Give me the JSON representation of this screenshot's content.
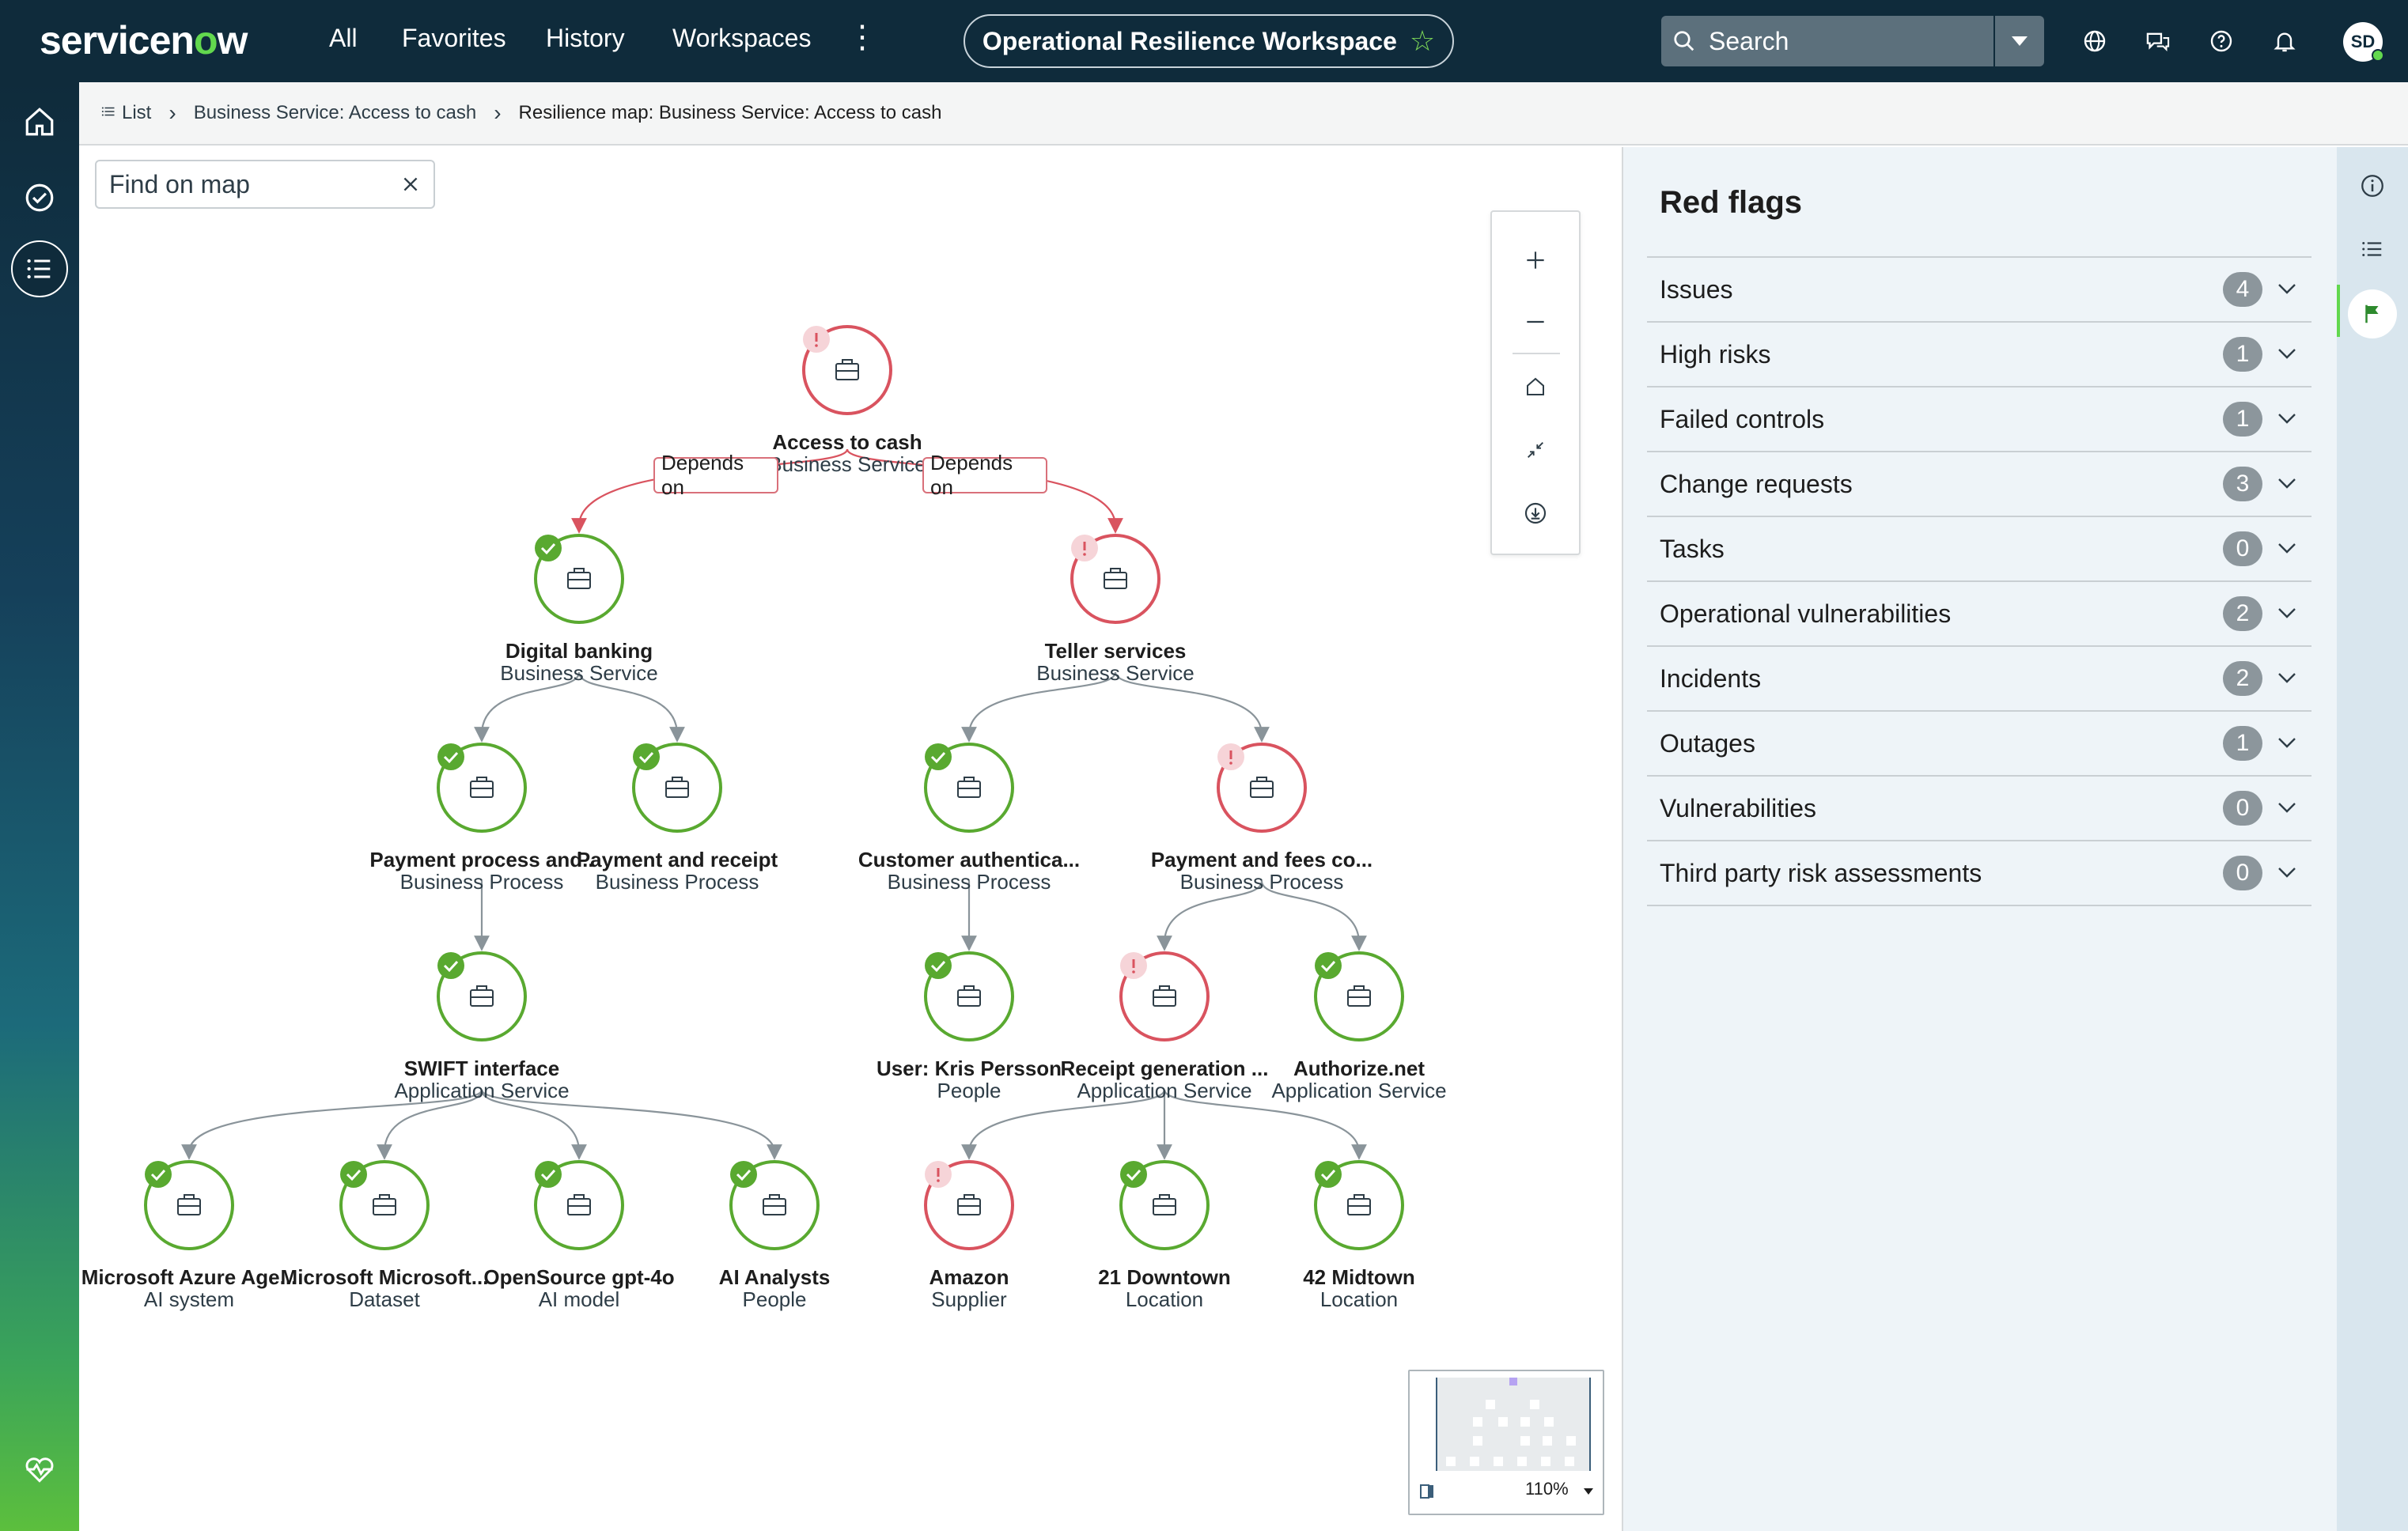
{
  "header": {
    "logo_pre": "servicen",
    "logo_o": "o",
    "logo_post": "w",
    "nav": [
      "All",
      "Favorites",
      "History",
      "Workspaces"
    ],
    "more": "⋮",
    "workspace": "Operational Resilience Workspace",
    "search_placeholder": "Search",
    "avatar": "SD"
  },
  "breadcrumb": {
    "list": "List",
    "service": "Business Service: Access to cash",
    "current": "Resilience map: Business Service: Access to cash"
  },
  "map": {
    "find_placeholder": "Find on map",
    "zoom_level": "110%",
    "edge_label": "Depends on",
    "nodes": [
      {
        "id": "n0",
        "title": "Access to cash",
        "sub": "Business Service",
        "status": "alert"
      },
      {
        "id": "n1",
        "title": "Digital banking",
        "sub": "Business Service",
        "status": "ok"
      },
      {
        "id": "n2",
        "title": "Teller services",
        "sub": "Business Service",
        "status": "alert"
      },
      {
        "id": "n3",
        "title": "Payment process and..",
        "sub": "Business Process",
        "status": "ok"
      },
      {
        "id": "n4",
        "title": "Payment and receipt",
        "sub": "Business Process",
        "status": "ok"
      },
      {
        "id": "n5",
        "title": "Customer authentica...",
        "sub": "Business Process",
        "status": "ok"
      },
      {
        "id": "n6",
        "title": "Payment and fees co...",
        "sub": "Business Process",
        "status": "alert"
      },
      {
        "id": "n7",
        "title": "SWIFT interface",
        "sub": "Application Service",
        "status": "ok"
      },
      {
        "id": "n8",
        "title": "User: Kris Persson",
        "sub": "People",
        "status": "ok"
      },
      {
        "id": "n9",
        "title": "Receipt generation ...",
        "sub": "Application Service",
        "status": "alert"
      },
      {
        "id": "n10",
        "title": "Authorize.net",
        "sub": "Application Service",
        "status": "ok"
      },
      {
        "id": "n11",
        "title": "Microsoft Azure Age...",
        "sub": "AI system",
        "status": "ok"
      },
      {
        "id": "n12",
        "title": "Microsoft Microsoft...",
        "sub": "Dataset",
        "status": "ok"
      },
      {
        "id": "n13",
        "title": "OpenSource gpt-4o",
        "sub": "AI model",
        "status": "ok"
      },
      {
        "id": "n14",
        "title": "AI Analysts",
        "sub": "People",
        "status": "ok"
      },
      {
        "id": "n15",
        "title": "Amazon",
        "sub": "Supplier",
        "status": "alert"
      },
      {
        "id": "n16",
        "title": "21 Downtown",
        "sub": "Location",
        "status": "ok"
      },
      {
        "id": "n17",
        "title": "42 Midtown",
        "sub": "Location",
        "status": "ok"
      }
    ]
  },
  "red_flags": {
    "title": "Red flags",
    "items": [
      {
        "label": "Issues",
        "count": "4"
      },
      {
        "label": "High risks",
        "count": "1"
      },
      {
        "label": "Failed controls",
        "count": "1"
      },
      {
        "label": "Change requests",
        "count": "3"
      },
      {
        "label": "Tasks",
        "count": "0"
      },
      {
        "label": "Operational vulnerabilities",
        "count": "2"
      },
      {
        "label": "Incidents",
        "count": "2"
      },
      {
        "label": "Outages",
        "count": "1"
      },
      {
        "label": "Vulnerabilities",
        "count": "0"
      },
      {
        "label": "Third party risk assessments",
        "count": "0"
      }
    ]
  },
  "colors": {
    "ok": "#59a930",
    "alert": "#d9535f",
    "alert_badge": "#f6d4d8",
    "edge": "#8a949a"
  }
}
